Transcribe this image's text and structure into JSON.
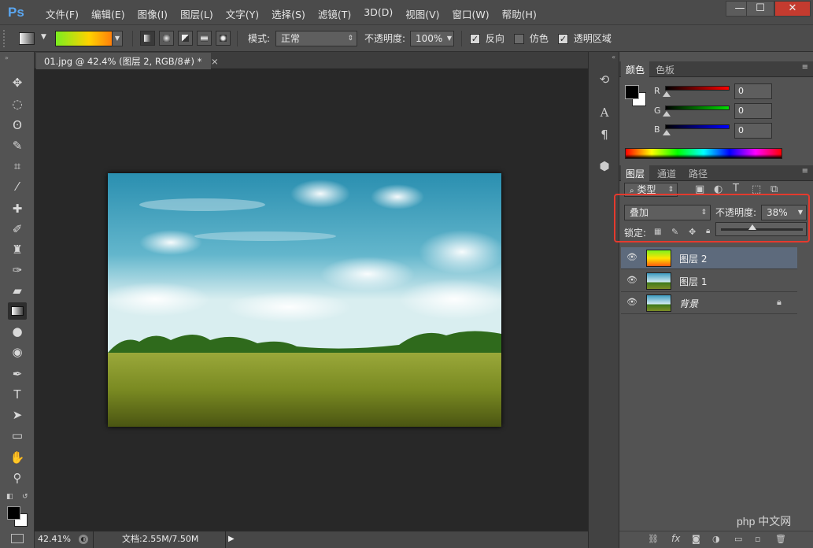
{
  "app": {
    "logo": "Ps"
  },
  "menu": [
    "文件(F)",
    "编辑(E)",
    "图像(I)",
    "图层(L)",
    "文字(Y)",
    "选择(S)",
    "滤镜(T)",
    "3D(D)",
    "视图(V)",
    "窗口(W)",
    "帮助(H)"
  ],
  "window_controls": {
    "minimize": "—",
    "maximize": "☐",
    "close": "✕"
  },
  "options": {
    "mode_label": "模式:",
    "mode_value": "正常",
    "opacity_label": "不透明度:",
    "opacity_value": "100%",
    "reverse_label": "反向",
    "reverse_checked": true,
    "dither_label": "仿色",
    "dither_checked": false,
    "transparency_label": "透明区域",
    "transparency_checked": true
  },
  "document": {
    "tab_title": "01.jpg @ 42.4% (图层 2, RGB/8#) *",
    "tab_close": "×",
    "zoom": "42.41%",
    "doc_info": "文档:2.55M/7.50M"
  },
  "color_panel": {
    "tabs": [
      "颜色",
      "色板"
    ],
    "r_label": "R",
    "r_value": "0",
    "g_label": "G",
    "g_value": "0",
    "b_label": "B",
    "b_value": "0",
    "foreground": "#000000",
    "background": "#ffffff"
  },
  "layers_panel": {
    "tabs": [
      "图层",
      "通道",
      "路径"
    ],
    "filter_label": "类型",
    "blend_mode": "叠加",
    "opacity_label": "不透明度:",
    "opacity_value": "38%",
    "opacity_fraction": 0.38,
    "lock_label": "锁定:",
    "layers": [
      {
        "name": "图层 2",
        "selected": true,
        "locked": false,
        "kind": "gradient"
      },
      {
        "name": "图层 1",
        "selected": false,
        "locked": false,
        "kind": "photo"
      },
      {
        "name": "背景",
        "selected": false,
        "locked": true,
        "kind": "photo"
      }
    ],
    "bottom_icons": [
      "link-icon",
      "fx-icon",
      "mask-icon",
      "adjustment-icon",
      "group-icon",
      "new-layer-icon",
      "trash-icon"
    ]
  },
  "watermark": "php 中文网",
  "colors": {
    "accent_highlight": "#e43a2e",
    "ps_blue": "#5aa6f0"
  }
}
